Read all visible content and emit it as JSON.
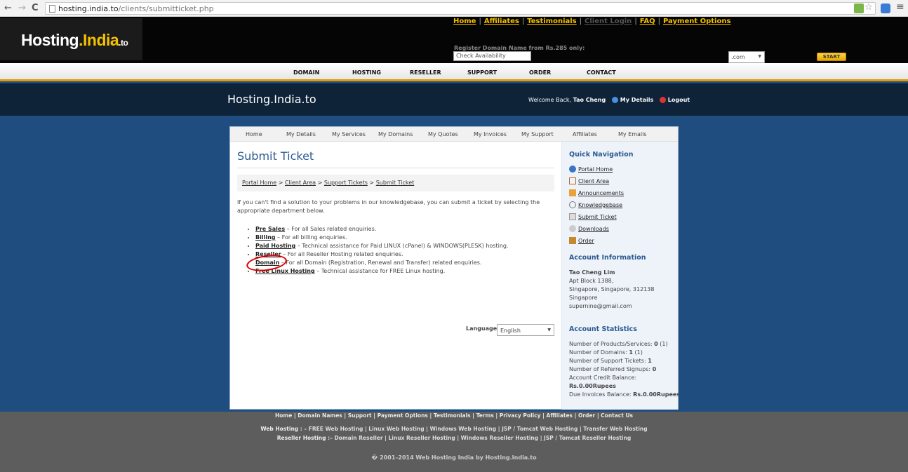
{
  "browser": {
    "url_host": "hosting.india.to",
    "url_path": "/clients/submitticket.php"
  },
  "header": {
    "logo_main": "Hosting",
    "logo_accent": ".India",
    "logo_suffix": ".to",
    "links": [
      "Home",
      "Affiliates",
      "Testimonials",
      "Client Login",
      "FAQ",
      "Payment Options"
    ],
    "register_text": "Register Domain Name from Rs.285 only:",
    "check_placeholder": "Check Availability",
    "tld": ".com",
    "start_label": "START"
  },
  "mainnav": [
    "DOMAIN",
    "HOSTING",
    "RESELLER",
    "SUPPORT",
    "ORDER",
    "CONTACT"
  ],
  "band": {
    "site_title": "Hosting.India.to",
    "welcome": "Welcome Back,",
    "user": "Tao Cheng",
    "my_details": "My Details",
    "logout": "Logout"
  },
  "subnav": [
    "Home",
    "My Details",
    "My Services",
    "My Domains",
    "My Quotes",
    "My Invoices",
    "My Support",
    "Affiliates",
    "My Emails"
  ],
  "main": {
    "title": "Submit Ticket",
    "breadcrumb": [
      "Portal Home",
      "Client Area",
      "Support Tickets",
      "Submit Ticket"
    ],
    "breadcrumb_sep": " > ",
    "intro_1": "If you can't find a solution to your problems in our knowledgebase, you can submit a ticket by selecting the",
    "intro_2": "appropriate department below.",
    "departments": [
      {
        "name": "Pre Sales",
        "desc": " – For all Sales related enquiries."
      },
      {
        "name": "Billing",
        "desc": " – For all billing enquiries."
      },
      {
        "name": "Paid Hosting",
        "desc": " – Technical assistance for Paid LINUX (cPanel) & WINDOWS(PLESK) hosting."
      },
      {
        "name": "Reseller",
        "desc": " – For all Reseller Hosting related enquiries."
      },
      {
        "name": "Domain",
        "desc": " – For all Domain (Registration, Renewal and Transfer) related enquiries."
      },
      {
        "name": "Free Linux Hosting",
        "desc": " – Technical assistance for FREE Linux hosting."
      }
    ],
    "language_label": "Language:",
    "language_value": "English"
  },
  "sidebar": {
    "quick_nav_title": "Quick Navigation",
    "quick_nav": [
      "Portal Home",
      "Client Area",
      "Announcements",
      "Knowledgebase",
      "Submit Ticket",
      "Downloads",
      "Order"
    ],
    "account_info_title": "Account Information",
    "account_name": "Tao Cheng Lim",
    "account_addr1": "Apt Block 1388,",
    "account_addr2": "Singapore, Singapore, 312138",
    "account_country": "Singapore",
    "account_email": "supernine@gmail.com",
    "account_stats_title": "Account Statistics",
    "stats": {
      "products_label": "Number of Products/Services:",
      "products_value": "0",
      "products_total": "(1)",
      "domains_label": "Number of Domains:",
      "domains_value": "1",
      "domains_total": "(1)",
      "tickets_label": "Number of Support Tickets:",
      "tickets_value": "1",
      "signups_label": "Number of Referred Signups:",
      "signups_value": "0",
      "credit_label": "Account Credit Balance:",
      "credit_value": "Rs.0.00Rupees",
      "due_label": "Due Invoices Balance:",
      "due_value": "Rs.0.00Rupees"
    }
  },
  "footer": {
    "row1": "Home | Domain Names | Support | Payment Options | Testimonials | Terms | Privacy Policy | Affiliates | Order | Contact Us",
    "row2_link": "Web Hosting",
    "row2_rest": " : – FREE Web Hosting | Linux Web Hosting | Windows Web Hosting | JSP / Tomcat Web Hosting | Transfer Web Hosting",
    "row3_link": "Reseller Hosting",
    "row3_rest": " :– Domain Reseller | Linux Reseller Hosting | Windows Reseller Hosting | JSP / Tomcat Reseller Hosting",
    "copyright": "� 2001–2014 Web Hosting India by Hosting.India.to"
  }
}
